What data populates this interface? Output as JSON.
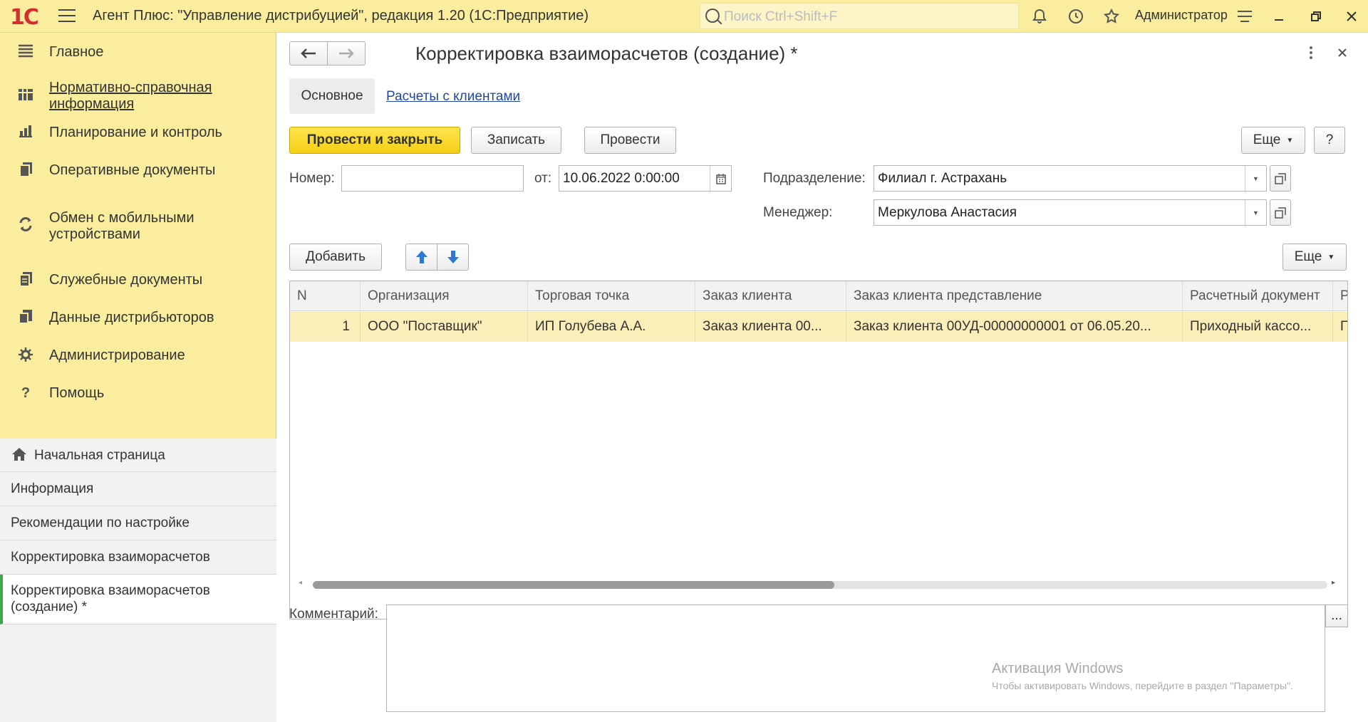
{
  "topbar": {
    "logo": "1С",
    "title": "Агент Плюс: \"Управление дистрибуцией\", редакция 1.20  (1С:Предприятие)",
    "search_placeholder": "Поиск Ctrl+Shift+F",
    "user": "Администратор"
  },
  "sidebar": {
    "items": [
      {
        "label": "Главное",
        "icon": "list-icon"
      },
      {
        "label": "Нормативно-справочная информация",
        "icon": "catalog-icon"
      },
      {
        "label": "Планирование и контроль",
        "icon": "chart-icon"
      },
      {
        "label": "Оперативные документы",
        "icon": "documents-icon"
      },
      {
        "label": "Обмен с мобильными устройствами",
        "icon": "sync-icon"
      },
      {
        "label": "Служебные документы",
        "icon": "service-documents-icon"
      },
      {
        "label": "Данные дистрибьюторов",
        "icon": "distributor-data-icon"
      },
      {
        "label": "Администрирование",
        "icon": "gear-icon"
      },
      {
        "label": "Помощь",
        "icon": "help-icon"
      }
    ],
    "open_windows": [
      {
        "label": "Начальная страница"
      },
      {
        "label": "Информация"
      },
      {
        "label": "Рекомендации по настройке"
      },
      {
        "label": "Корректировка взаиморасчетов"
      },
      {
        "label": "Корректировка взаиморасчетов (создание) *"
      }
    ]
  },
  "form": {
    "title": "Корректировка взаиморасчетов (создание) *",
    "tabs": [
      "Основное",
      "Расчеты с клиентами"
    ],
    "buttons": {
      "post_close": "Провести и закрыть",
      "save": "Записать",
      "post": "Провести",
      "more": "Еще",
      "help": "?"
    },
    "fields": {
      "number_label": "Номер:",
      "number_value": "",
      "date_label": "от:",
      "date_value": "10.06.2022  0:00:00",
      "division_label": "Подразделение:",
      "division_value": "Филиал г. Астрахань",
      "manager_label": "Менеджер:",
      "manager_value": "Меркулова Анастасия",
      "comment_label": "Комментарий:",
      "comment_value": "",
      "comment_btn": "..."
    },
    "table_toolbar": {
      "add": "Добавить",
      "more": "Еще"
    },
    "table": {
      "columns": [
        "N",
        "Организация",
        "Торговая точка",
        "Заказ клиента",
        "Заказ клиента представление",
        "Расчетный документ",
        "Р"
      ],
      "rows": [
        [
          "1",
          "ООО \"Поставщик\"",
          "ИП Голубева А.А.",
          "Заказ клиента 00...",
          "Заказ клиента 00УД-00000000001 от 06.05.20...",
          "Приходный кассо...",
          "П"
        ]
      ]
    }
  },
  "watermark": {
    "line1": "Активация Windows",
    "line2": "Чтобы активировать Windows, перейдите в раздел \"Параметры\"."
  }
}
